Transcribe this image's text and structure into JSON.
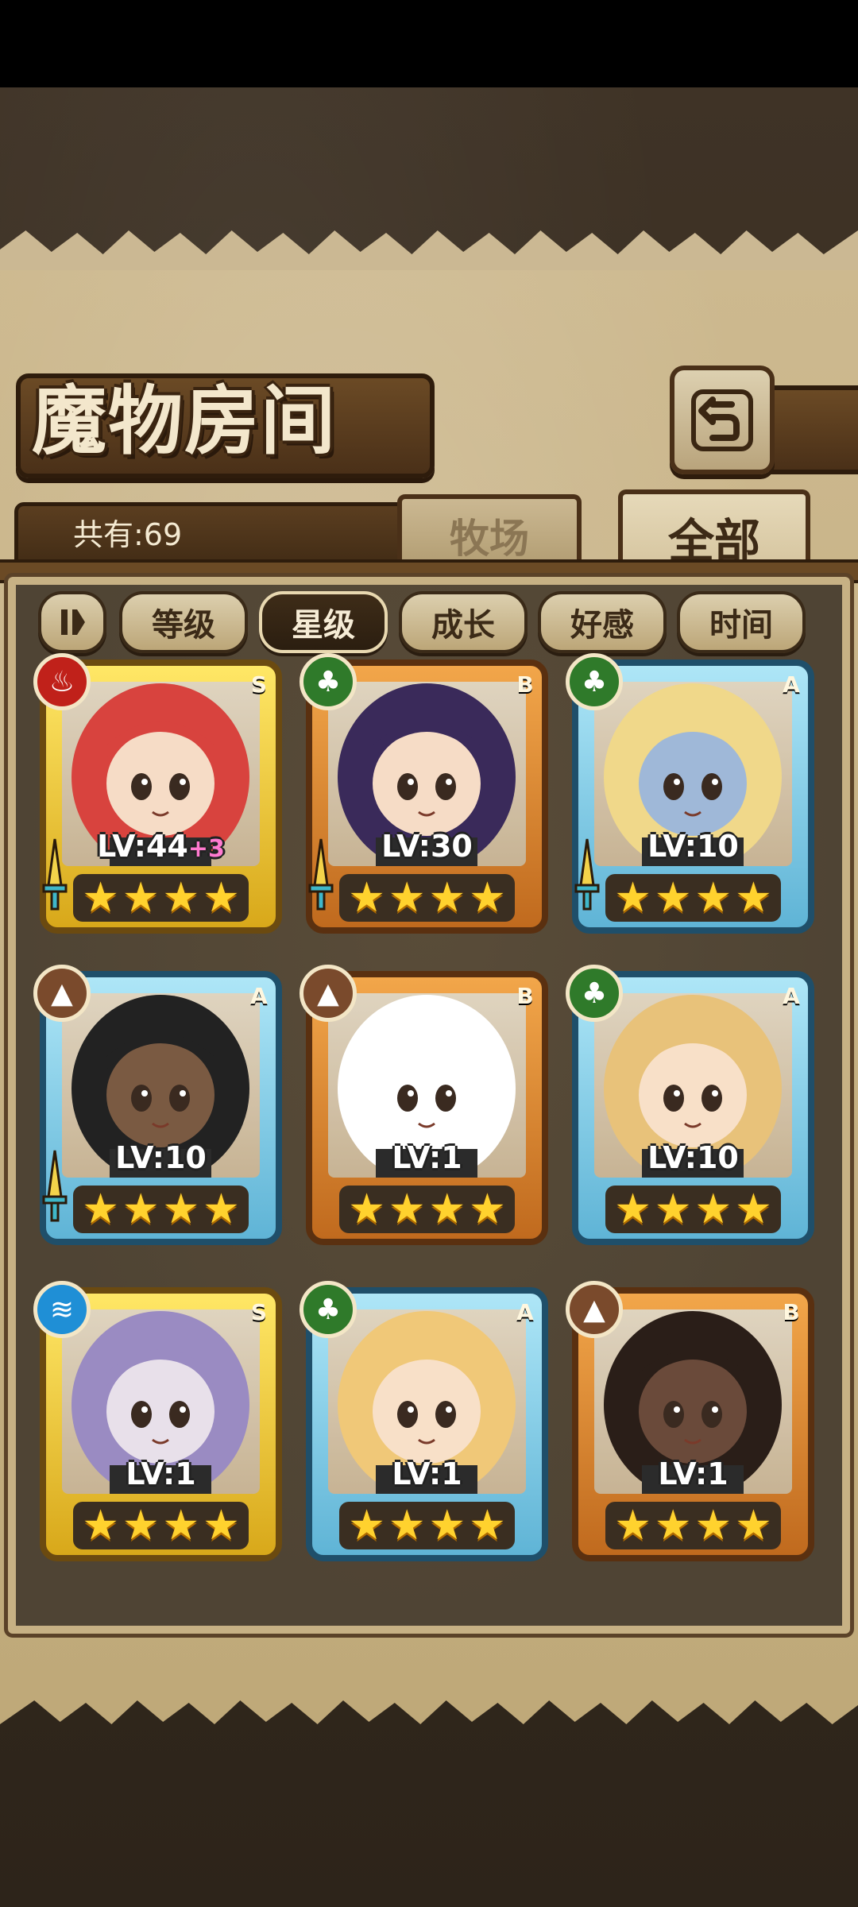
{
  "header": {
    "title": "魔物房间"
  },
  "count": {
    "label": "共有:69"
  },
  "tabs": [
    {
      "label": "牧场",
      "active": false
    },
    {
      "label": "全部",
      "active": true
    }
  ],
  "sort": {
    "toggle_icon": "pause-bars-icon",
    "buttons": [
      {
        "label": "等级",
        "active": false
      },
      {
        "label": "星级",
        "active": true
      },
      {
        "label": "成长",
        "active": false
      },
      {
        "label": "好感",
        "active": false
      },
      {
        "label": "时间",
        "active": false
      }
    ]
  },
  "monsters": [
    {
      "rank": "S",
      "element": "fire",
      "level": "LV:44",
      "bonus": "+3",
      "stars": 4,
      "equipped_sword": true,
      "hair": "#d8433e",
      "skin": "#f6dcc6"
    },
    {
      "rank": "B",
      "element": "wood",
      "level": "LV:30",
      "bonus": "",
      "stars": 4,
      "equipped_sword": true,
      "hair": "#3a2a5a",
      "skin": "#f6dcc6"
    },
    {
      "rank": "A",
      "element": "wood",
      "level": "LV:10",
      "bonus": "",
      "stars": 4,
      "equipped_sword": true,
      "hair": "#f0d88a",
      "skin": "#9fb8d8"
    },
    {
      "rank": "A",
      "element": "earth",
      "level": "LV:10",
      "bonus": "",
      "stars": 4,
      "equipped_sword": true,
      "hair": "#222222",
      "skin": "#7a5a42"
    },
    {
      "rank": "B",
      "element": "earth",
      "level": "LV:1",
      "bonus": "",
      "stars": 4,
      "equipped_sword": false,
      "hair": "#ffffff",
      "skin": "#ffffff"
    },
    {
      "rank": "A",
      "element": "wood",
      "level": "LV:10",
      "bonus": "",
      "stars": 4,
      "equipped_sword": false,
      "hair": "#e8c27a",
      "skin": "#f8e0c8"
    },
    {
      "rank": "S",
      "element": "water",
      "level": "LV:1",
      "bonus": "",
      "stars": 4,
      "equipped_sword": false,
      "hair": "#9a8bc2",
      "skin": "#e8e0ea"
    },
    {
      "rank": "A",
      "element": "wood",
      "level": "LV:1",
      "bonus": "",
      "stars": 4,
      "equipped_sword": false,
      "hair": "#f0c878",
      "skin": "#f8e0c8"
    },
    {
      "rank": "B",
      "element": "earth",
      "level": "LV:1",
      "bonus": "",
      "stars": 4,
      "equipped_sword": false,
      "hair": "#2a1e18",
      "skin": "#6a4a3a"
    }
  ],
  "element_icons": {
    "fire": "fire-icon",
    "wood": "leaf-icon",
    "earth": "mountain-icon",
    "water": "water-waves-icon"
  },
  "colors": {
    "rank_S": "#ffe766",
    "rank_A": "#aee6f7",
    "rank_B": "#f2a64a",
    "star": "#ffd22e"
  }
}
